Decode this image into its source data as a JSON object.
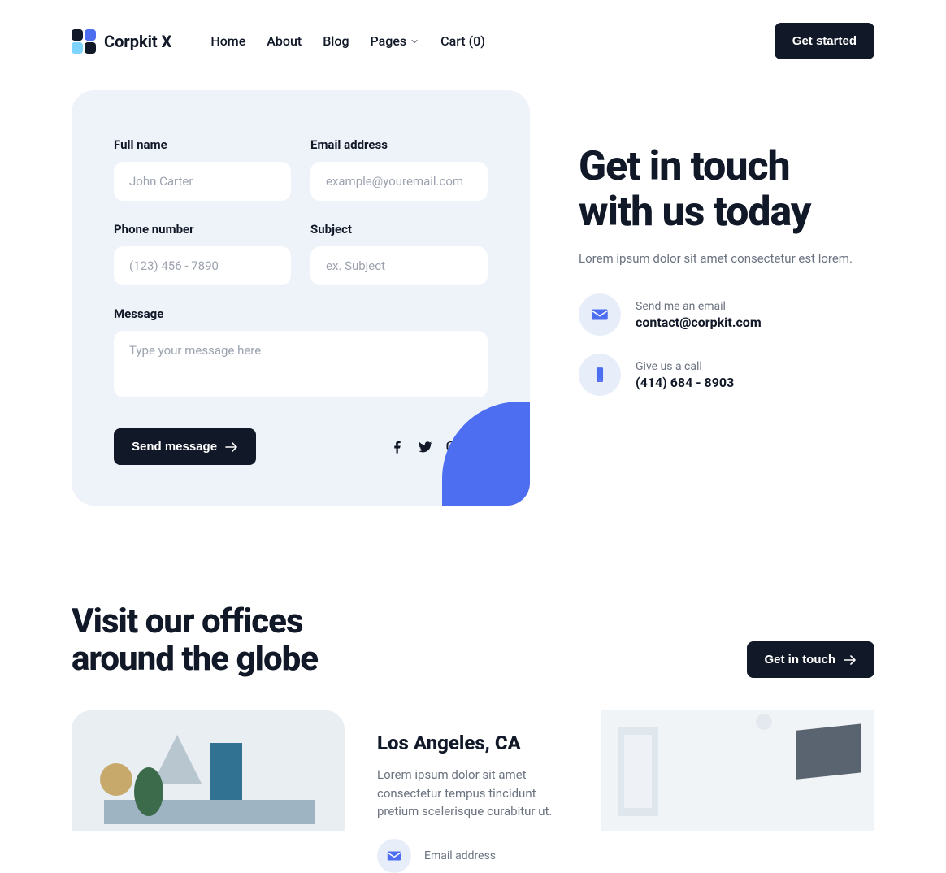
{
  "brand": "Corpkit X",
  "nav": {
    "home": "Home",
    "about": "About",
    "blog": "Blog",
    "pages": "Pages",
    "cart": "Cart (0)"
  },
  "header_cta": "Get started",
  "form": {
    "full_name_label": "Full name",
    "full_name_placeholder": "John Carter",
    "email_label": "Email address",
    "email_placeholder": "example@youremail.com",
    "phone_label": "Phone number",
    "phone_placeholder": "(123) 456 - 7890",
    "subject_label": "Subject",
    "subject_placeholder": "ex. Subject",
    "message_label": "Message",
    "message_placeholder": "Type your message here",
    "submit": "Send message"
  },
  "contact": {
    "title_line1": "Get in touch",
    "title_line2": "with us today",
    "subtitle": "Lorem ipsum dolor sit amet consectetur est lorem.",
    "email_label": "Send me an email",
    "email_value": "contact@corpkit.com",
    "phone_label": "Give us a call",
    "phone_value": "(414) 684 - 8903"
  },
  "offices": {
    "title_line1": "Visit our offices",
    "title_line2": "around the globe",
    "cta": "Get in touch",
    "city": "Los Angeles, CA",
    "desc": "Lorem ipsum dolor sit amet consectetur tempus tincidunt pretium scelerisque curabitur ut.",
    "email_label": "Email address"
  }
}
